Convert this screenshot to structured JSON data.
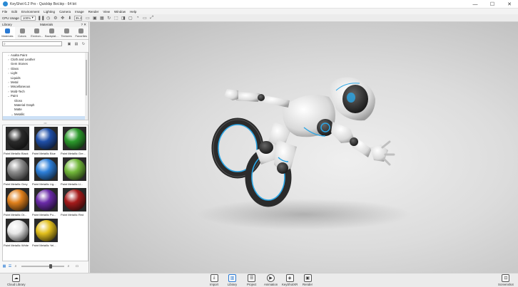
{
  "window": {
    "title": "KeyShot 6.2 Pro - Quickbp Bot.bip - 64 bit"
  },
  "window_controls": {
    "minimize": "—",
    "maximize": "☐",
    "close": "✕"
  },
  "menu": [
    "File",
    "Edit",
    "Environment",
    "Lighting",
    "Camera",
    "Image",
    "Render",
    "View",
    "Window",
    "Help"
  ],
  "toolbar": {
    "cpu_label": "CPU Usage",
    "cpu_value": "100%",
    "field_value": "35.2"
  },
  "library": {
    "title": "Library",
    "subtitle": "Materials",
    "controls": "? ✕",
    "tabs": [
      {
        "label": "Materials",
        "icon": "sphere-icon",
        "active": true
      },
      {
        "label": "Colors",
        "icon": "palette-icon"
      },
      {
        "label": "Environ...",
        "icon": "globe-icon"
      },
      {
        "label": "Backplat...",
        "icon": "image-icon"
      },
      {
        "label": "Textures",
        "icon": "texture-icon"
      },
      {
        "label": "Favorites",
        "icon": "star-icon"
      }
    ],
    "search_placeholder": "",
    "tree": [
      {
        "label": "Axalta Paint",
        "indent": 1,
        "arrow": "›"
      },
      {
        "label": "Cloth and Leather",
        "indent": 1,
        "arrow": "›"
      },
      {
        "label": "Gem Stones",
        "indent": 1,
        "arrow": ""
      },
      {
        "label": "Glass",
        "indent": 1,
        "arrow": "›"
      },
      {
        "label": "Light",
        "indent": 1,
        "arrow": "›"
      },
      {
        "label": "Liquids",
        "indent": 1,
        "arrow": ""
      },
      {
        "label": "Metal",
        "indent": 1,
        "arrow": "›"
      },
      {
        "label": "Miscellaneous",
        "indent": 1,
        "arrow": "›"
      },
      {
        "label": "Mold-Tech",
        "indent": 1,
        "arrow": "›"
      },
      {
        "label": "Paint",
        "indent": 1,
        "arrow": "⌄"
      },
      {
        "label": "Gloss",
        "indent": 2,
        "arrow": ""
      },
      {
        "label": "Material Graph",
        "indent": 2,
        "arrow": ""
      },
      {
        "label": "Matte",
        "indent": 2,
        "arrow": ""
      },
      {
        "label": "Metallic",
        "indent": 2,
        "arrow": "⌄"
      },
      {
        "label": "",
        "indent": 3,
        "arrow": "",
        "selected": true
      }
    ],
    "materials": [
      {
        "label": "Paint Metallic Black",
        "color": "#2b2b2b"
      },
      {
        "label": "Paint Metallic Blue",
        "color": "#1f4fa8"
      },
      {
        "label": "Paint Metallic Gre...",
        "color": "#2c9a2c"
      },
      {
        "label": "Paint Metallic Grey",
        "color": "#8e8e8e"
      },
      {
        "label": "Paint Metallic Lig...",
        "color": "#2d7fd9"
      },
      {
        "label": "Paint Metallic Li...",
        "color": "#72b83a"
      },
      {
        "label": "Paint Metallic Or...",
        "color": "#e0801c"
      },
      {
        "label": "Paint Metallic Pu...",
        "color": "#6a2aa8"
      },
      {
        "label": "Paint Metallic Red",
        "color": "#a51b1b"
      },
      {
        "label": "Paint Metallic White",
        "color": "#e8e8e8"
      },
      {
        "label": "Paint Metallic Yel...",
        "color": "#e2bf1c"
      }
    ],
    "zoom_fraction": 0.7
  },
  "bottom_bar": {
    "left": {
      "label": "Cloud Library",
      "icon": "cloud-icon"
    },
    "center": [
      {
        "label": "Import",
        "icon": "import-icon"
      },
      {
        "label": "Library",
        "icon": "library-icon"
      },
      {
        "label": "Project",
        "icon": "project-icon"
      },
      {
        "label": "Animation",
        "icon": "animation-icon"
      },
      {
        "label": "KeyShotXR",
        "icon": "keyshotxr-icon"
      },
      {
        "label": "Render",
        "icon": "render-icon"
      }
    ],
    "right": {
      "label": "Screenshot",
      "icon": "screenshot-icon"
    }
  },
  "colors": {
    "accent": "#2a7ad4",
    "viewport_bg": "#d8d8d8"
  }
}
